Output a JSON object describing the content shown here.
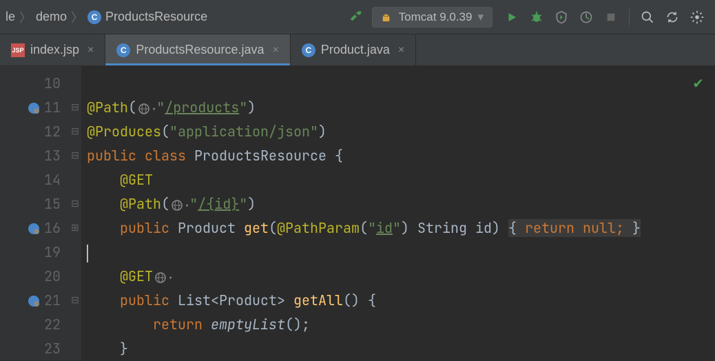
{
  "breadcrumb": {
    "p1": "le",
    "p2": "demo",
    "p3": "ProductsResource"
  },
  "runConfig": "Tomcat 9.0.39",
  "tabs": [
    {
      "label": "index.jsp",
      "active": false,
      "type": "jsp"
    },
    {
      "label": "ProductsResource.java",
      "active": true,
      "type": "class"
    },
    {
      "label": "Product.java",
      "active": false,
      "type": "class"
    }
  ],
  "lineNumbers": [
    "10",
    "11",
    "12",
    "13",
    "14",
    "15",
    "16",
    "19",
    "20",
    "21",
    "22",
    "23"
  ],
  "code": {
    "l11": {
      "anno": "@Path",
      "op": "(",
      "str": "\"",
      "path": "/products",
      "strEnd": "\"",
      "cp": ")"
    },
    "l12": {
      "anno": "@Produces",
      "op": "(",
      "str": "\"application/json\"",
      "cp": ")"
    },
    "l13": {
      "k1": "public",
      "k2": "class",
      "name": "ProductsResource",
      "br": " {"
    },
    "l14": {
      "anno": "@GET"
    },
    "l15": {
      "anno": "@Path",
      "op": "(",
      "str": "\"",
      "path": "/{id}",
      "strEnd": "\"",
      "cp": ")"
    },
    "l16": {
      "k1": "public",
      "type": "Product",
      "m": "get",
      "a": "@PathParam",
      "str": "\"",
      "p": "id",
      "strEnd": "\"",
      "t2": "String",
      "arg": "id",
      "body": "{ ",
      "kw": "return",
      "nul": " null; ",
      "cb": "}"
    },
    "l20": {
      "anno": "@GET"
    },
    "l21": {
      "k1": "public",
      "type": "List<Product>",
      "m": "getAll",
      "par": "() {"
    },
    "l22": {
      "kw": "return",
      "call": "emptyList",
      "par": "();"
    },
    "l23": {
      "br": "}"
    }
  }
}
